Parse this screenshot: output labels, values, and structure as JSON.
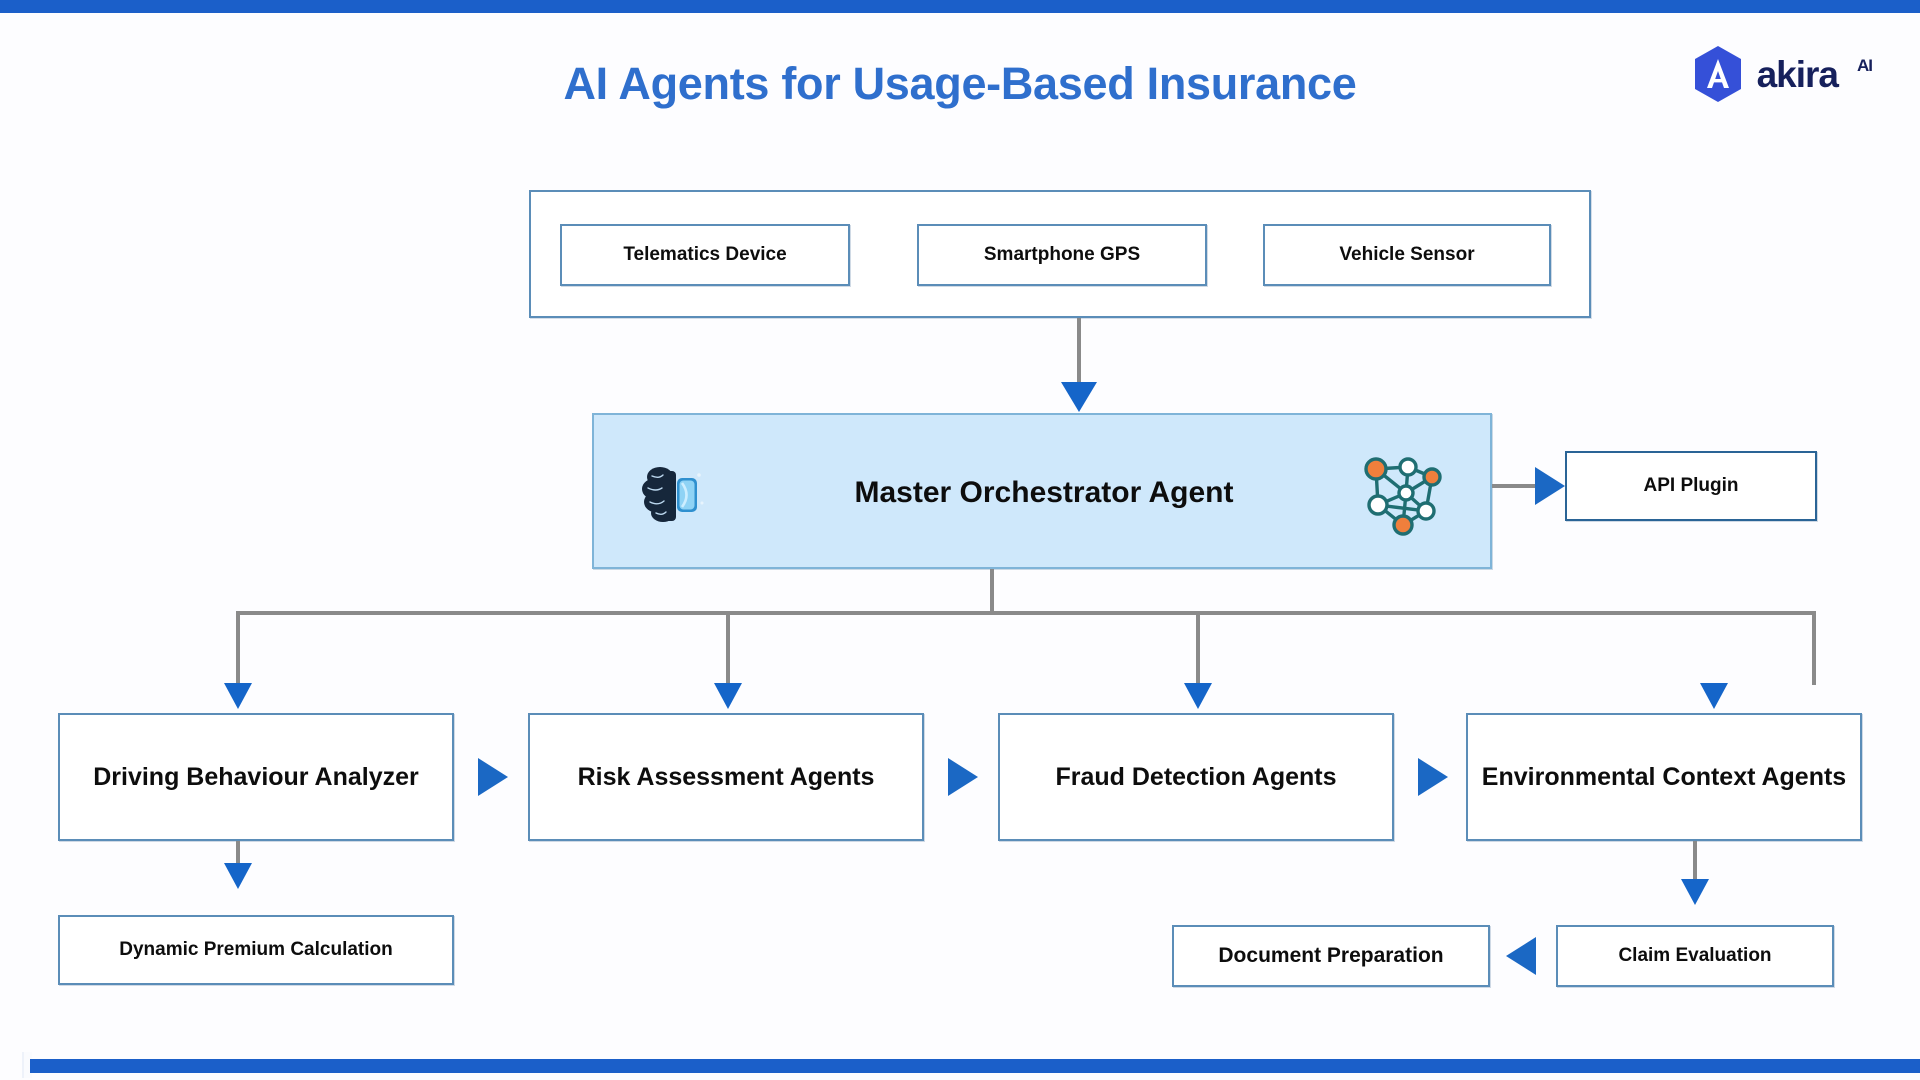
{
  "header": {
    "title": "AI Agents for Usage-Based Insurance",
    "logo_text": "akira",
    "logo_superscript": "AI",
    "logo_mark_letter": "A"
  },
  "colors": {
    "brand_bar": "#1b5fc9",
    "title_blue": "#2f6fcd",
    "box_border": "#5b8db8",
    "orchestrator_fill": "#cfe8fb",
    "orchestrator_border": "#7fb4d8",
    "arrow_blue": "#1565c9",
    "connector_gray": "#8a8a8a",
    "logo_navy": "#16205c",
    "node_orange": "#ef7f3c",
    "node_teal": "#1f6e72"
  },
  "data_sources": {
    "items": [
      {
        "label": "Telematics Device"
      },
      {
        "label": "Smartphone GPS"
      },
      {
        "label": "Vehicle Sensor"
      }
    ]
  },
  "orchestrator": {
    "label": "Master Orchestrator Agent",
    "left_icon": "brain-chip-icon",
    "right_icon": "neural-network-icon"
  },
  "api": {
    "label": "API Plugin"
  },
  "agents": [
    {
      "label": "Driving Behaviour Analyzer"
    },
    {
      "label": "Risk Assessment Agents"
    },
    {
      "label": "Fraud Detection Agents"
    },
    {
      "label": "Environmental Context Agents"
    }
  ],
  "outcomes": {
    "premium": "Dynamic Premium Calculation",
    "document": "Document Preparation",
    "claim": "Claim Evaluation"
  }
}
